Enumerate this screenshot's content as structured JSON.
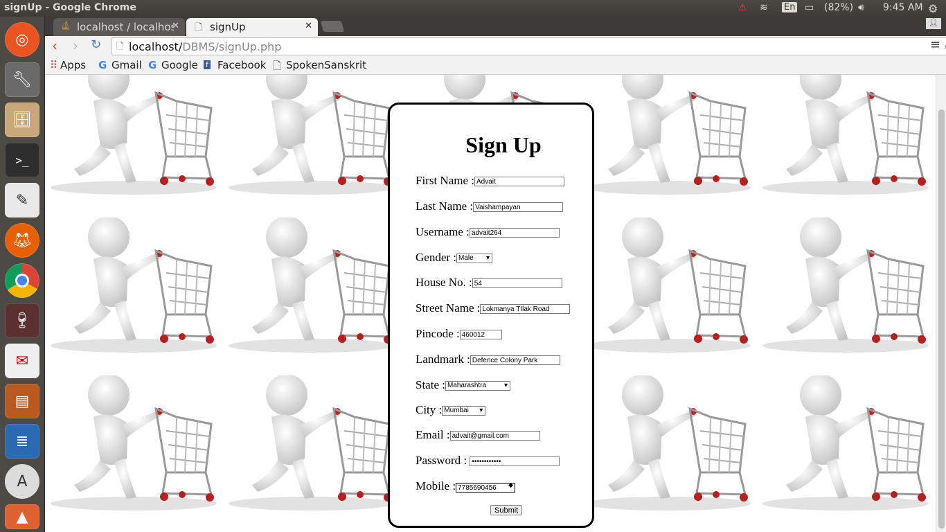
{
  "system": {
    "window_title": "signUp - Google Chrome",
    "keyboard": "En",
    "battery": "(82%)",
    "time": "9:45 AM"
  },
  "tabs": [
    {
      "label": "localhost / localhost"
    },
    {
      "label": "signUp"
    }
  ],
  "address": {
    "host": "localhost/",
    "path": "DBMS/signUp.php"
  },
  "bookmarks": [
    {
      "label": "Apps"
    },
    {
      "label": "Gmail"
    },
    {
      "label": "Google"
    },
    {
      "label": "Facebook"
    },
    {
      "label": "SpokenSanskrit"
    }
  ],
  "form": {
    "heading": "Sign Up",
    "first_name": {
      "label": "First Name :",
      "value": "Advait"
    },
    "last_name": {
      "label": "Last Name :",
      "value": "Vaishampayan"
    },
    "username": {
      "label": "Username :",
      "value": "advait264"
    },
    "gender": {
      "label": "Gender :",
      "value": "Male"
    },
    "house_no": {
      "label": "House No. :",
      "value": "54"
    },
    "street": {
      "label": "Street Name :",
      "value": "Lokmanya TIlak Road"
    },
    "pincode": {
      "label": "Pincode :",
      "value": "460012"
    },
    "landmark": {
      "label": "Landmark :",
      "value": "Defence Colony Park"
    },
    "state": {
      "label": "State :",
      "value": "Maharashtra"
    },
    "city": {
      "label": "City :",
      "value": "Mumbai"
    },
    "email": {
      "label": "Email :",
      "value": "advait@gmail.com"
    },
    "password": {
      "label": "Password :",
      "value": "••••••••••••"
    },
    "mobile": {
      "label": "Mobile :",
      "value": "7785690456"
    },
    "submit": "Submit"
  }
}
